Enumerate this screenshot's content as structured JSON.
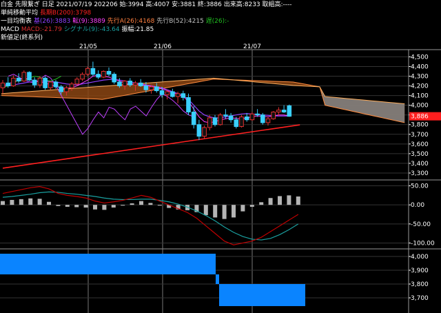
{
  "header": {
    "line1": {
      "text": "白金 先限繋ぎ 日足 2021/07/19 202206 始:3994 高:4007 安:3881 終:3886 出来高:8233 取組高:----"
    },
    "line2": {
      "label": "単純移動平均",
      "ma_text": "長期B(200):3798"
    },
    "line3": {
      "label": "一目均衡表",
      "base": "基(26):3883",
      "conv": "転(9):3889",
      "spanA": "先行A(26):4168",
      "spanB": "先行B(52):4215",
      "lag": "遅(26):-"
    },
    "line4": {
      "label": "MACD",
      "macd": "MACD:-21.79",
      "signal": "シグナル(9):-43.64",
      "osc": "振幅:21.85"
    },
    "line5": {
      "label": "新値足(終系列)"
    }
  },
  "x_axis": [
    "21/05",
    "21/06",
    "21/07"
  ],
  "price_axis": [
    "4,500",
    "4,400",
    "4,300",
    "4,200",
    "4,100",
    "4,000",
    "3,900",
    "3,800",
    "3,700",
    "3,600",
    "3,500",
    "3,400",
    "3,300"
  ],
  "current_price": "3,886",
  "macd_axis": [
    "50.00",
    "0.00",
    "-50.00",
    "-100.00"
  ],
  "renko_axis": [
    "4,000",
    "3,900",
    "3,800",
    "3,700"
  ],
  "colors": {
    "up": "#e03030",
    "down": "#3ad0ff",
    "ma200": "#ff2020",
    "tenkan": "#ff3fff",
    "kijun": "#9040ff",
    "chikou": "#20c020",
    "cloud_bull": "#8b4513",
    "cloud_bear": "#808080",
    "macd_line": "#c00000",
    "signal_line": "#1aa0a0",
    "hist": "#b4b4b4",
    "renko": "#0a84ff"
  },
  "chart_data": [
    {
      "type": "candlestick",
      "title": "白金 先限繋ぎ 日足",
      "x": [
        "21/05",
        "21/06",
        "21/07"
      ],
      "ylim": [
        3250,
        4560
      ],
      "candles": [
        [
          4180,
          4260,
          4120,
          4230
        ],
        [
          4230,
          4290,
          4180,
          4200
        ],
        [
          4200,
          4310,
          4190,
          4280
        ],
        [
          4280,
          4330,
          4230,
          4250
        ],
        [
          4250,
          4360,
          4240,
          4340
        ],
        [
          4340,
          4350,
          4250,
          4260
        ],
        [
          4260,
          4290,
          4180,
          4210
        ],
        [
          4210,
          4300,
          4180,
          4280
        ],
        [
          4280,
          4300,
          4160,
          4180
        ],
        [
          4180,
          4250,
          4160,
          4240
        ],
        [
          4240,
          4260,
          4170,
          4190
        ],
        [
          4190,
          4210,
          4110,
          4140
        ],
        [
          4140,
          4200,
          4100,
          4180
        ],
        [
          4180,
          4240,
          4150,
          4220
        ],
        [
          4220,
          4290,
          4200,
          4270
        ],
        [
          4270,
          4340,
          4250,
          4320
        ],
        [
          4320,
          4400,
          4300,
          4380
        ],
        [
          4380,
          4450,
          4300,
          4320
        ],
        [
          4320,
          4360,
          4270,
          4290
        ],
        [
          4290,
          4360,
          4280,
          4350
        ],
        [
          4350,
          4390,
          4300,
          4320
        ],
        [
          4320,
          4340,
          4220,
          4240
        ],
        [
          4240,
          4280,
          4180,
          4200
        ],
        [
          4200,
          4260,
          4160,
          4250
        ],
        [
          4250,
          4280,
          4190,
          4210
        ],
        [
          4210,
          4250,
          4150,
          4230
        ],
        [
          4230,
          4270,
          4190,
          4200
        ],
        [
          4200,
          4240,
          4130,
          4160
        ],
        [
          4160,
          4210,
          4120,
          4190
        ],
        [
          4190,
          4230,
          4130,
          4150
        ],
        [
          4150,
          4190,
          4080,
          4110
        ],
        [
          4110,
          4160,
          4060,
          4140
        ],
        [
          4140,
          4170,
          4080,
          4090
        ],
        [
          4090,
          4140,
          4020,
          4120
        ],
        [
          4120,
          4150,
          4050,
          4080
        ],
        [
          4080,
          4120,
          3900,
          3930
        ],
        [
          3930,
          3990,
          3760,
          3800
        ],
        [
          3800,
          3850,
          3640,
          3680
        ],
        [
          3680,
          3790,
          3650,
          3770
        ],
        [
          3770,
          3900,
          3740,
          3870
        ],
        [
          3870,
          3900,
          3780,
          3800
        ],
        [
          3800,
          3920,
          3790,
          3900
        ],
        [
          3900,
          3960,
          3860,
          3890
        ],
        [
          3890,
          3920,
          3820,
          3850
        ],
        [
          3850,
          3880,
          3760,
          3780
        ],
        [
          3780,
          3900,
          3770,
          3880
        ],
        [
          3880,
          3920,
          3830,
          3850
        ],
        [
          3850,
          3930,
          3840,
          3910
        ],
        [
          3910,
          3960,
          3880,
          3900
        ],
        [
          3900,
          3920,
          3800,
          3820
        ],
        [
          3820,
          3880,
          3790,
          3860
        ],
        [
          3860,
          3940,
          3850,
          3930
        ],
        [
          3930,
          3980,
          3890,
          3950
        ],
        [
          3950,
          4000,
          3920,
          3930
        ],
        [
          3994,
          4007,
          3881,
          3886
        ]
      ],
      "series": [
        {
          "name": "長期B(200)",
          "values": [
            3350,
            3358,
            3366,
            3374,
            3382,
            3390,
            3398,
            3406,
            3414,
            3422,
            3430,
            3438,
            3446,
            3454,
            3462,
            3470,
            3478,
            3486,
            3494,
            3502,
            3510,
            3518,
            3526,
            3534,
            3542,
            3550,
            3558,
            3566,
            3574,
            3582,
            3590,
            3598,
            3606,
            3614,
            3622,
            3630,
            3638,
            3646,
            3654,
            3662,
            3670,
            3678,
            3686,
            3694,
            3702,
            3710,
            3718,
            3726,
            3734,
            3742,
            3750,
            3758,
            3766,
            3774,
            3782,
            3790,
            3798
          ]
        }
      ]
    },
    {
      "type": "line",
      "title": "MACD",
      "ylim": [
        -110,
        60
      ],
      "series": [
        {
          "name": "MACD",
          "values": [
            30,
            35,
            40,
            45,
            48,
            42,
            30,
            25,
            22,
            18,
            10,
            5,
            8,
            12,
            18,
            25,
            20,
            10,
            0,
            -10,
            -20,
            -35,
            -55,
            -75,
            -95,
            -105,
            -100,
            -95,
            -85,
            -70,
            -55,
            -40,
            -25
          ]
        },
        {
          "name": "シグナル(9)",
          "values": [
            20,
            22,
            25,
            28,
            32,
            34,
            33,
            30,
            28,
            25,
            22,
            18,
            15,
            14,
            14,
            15,
            15,
            12,
            8,
            2,
            -6,
            -16,
            -28,
            -42,
            -58,
            -72,
            -83,
            -90,
            -92,
            -88,
            -78,
            -65,
            -50
          ]
        },
        {
          "name": "振幅",
          "values": [
            10,
            13,
            15,
            17,
            16,
            8,
            -3,
            -5,
            -6,
            -7,
            -12,
            -13,
            -7,
            -2,
            4,
            10,
            5,
            -2,
            -8,
            -12,
            -14,
            -19,
            -27,
            -33,
            -37,
            -33,
            -17,
            -5,
            7,
            18,
            23,
            25,
            22
          ]
        }
      ]
    },
    {
      "type": "bar",
      "title": "新値足(終系列)",
      "ylim": [
        3600,
        4040
      ],
      "values": [
        4020,
        3870,
        3640
      ]
    }
  ]
}
